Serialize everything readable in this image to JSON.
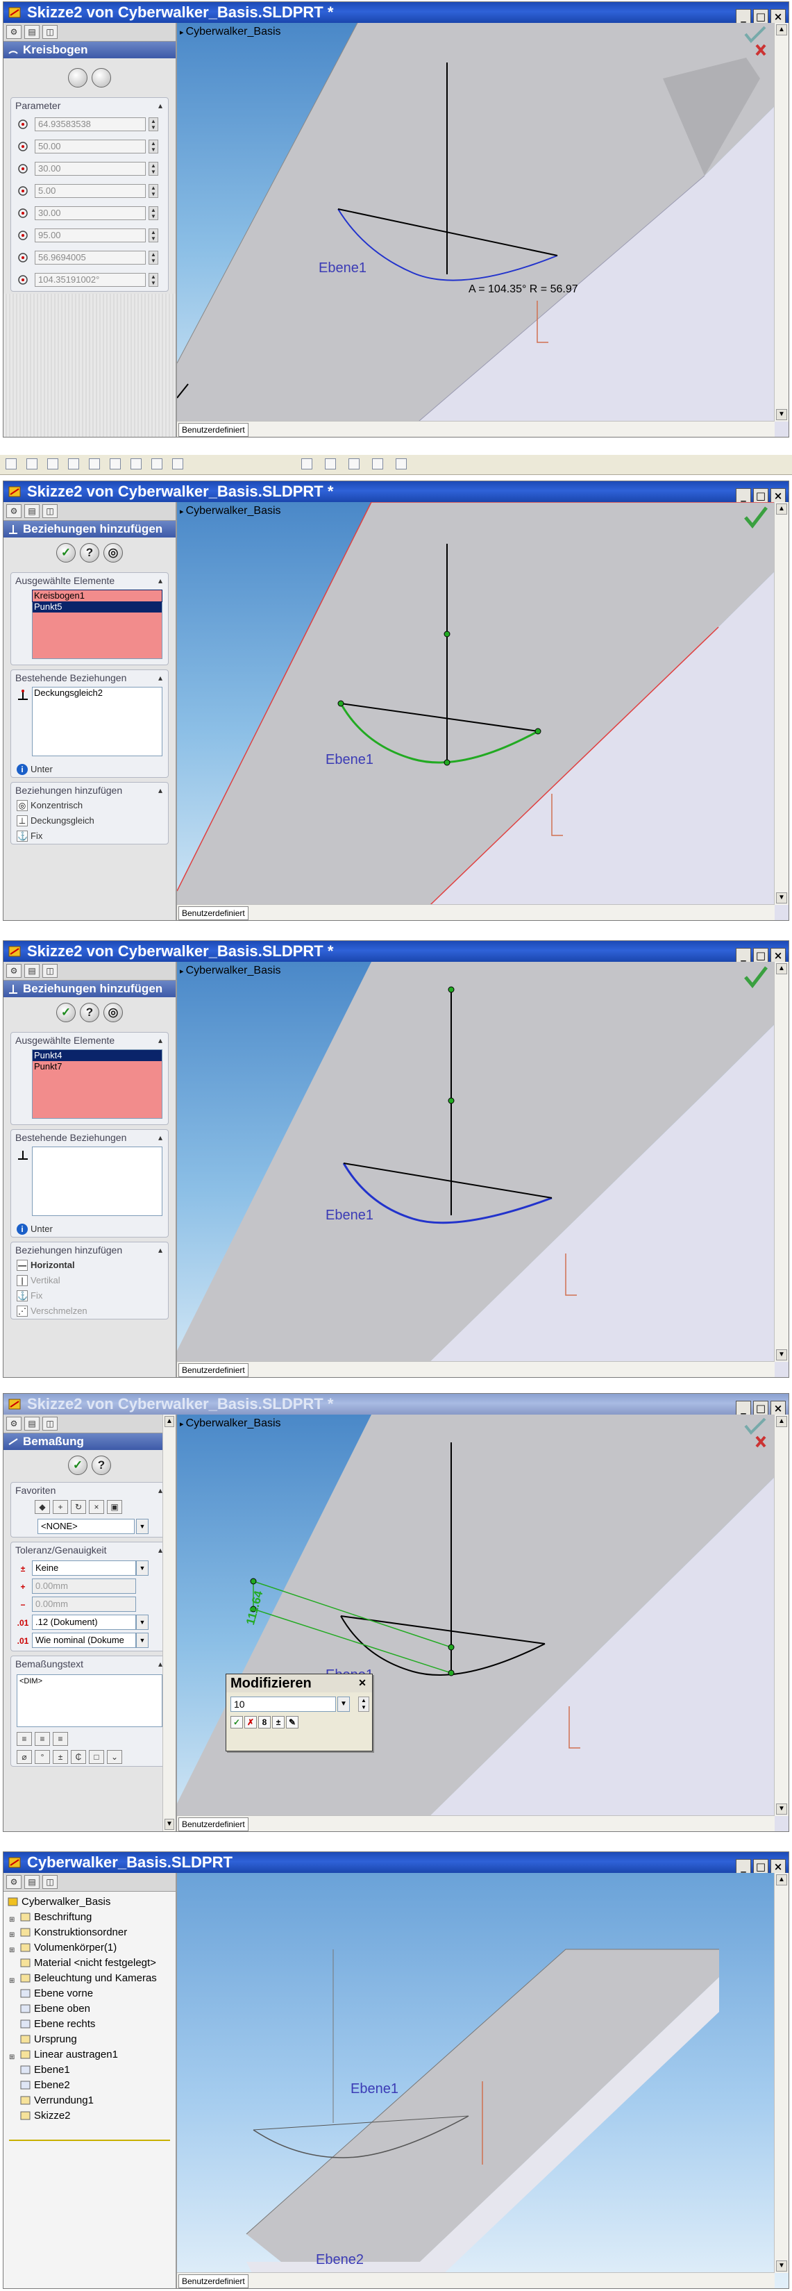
{
  "colors": {
    "titlebar_active": "#2f62d8",
    "selection": "#0a246a",
    "pink_listbox": "#f28c8c",
    "sketch_blue": "#2233cc",
    "sketch_green": "#22aa22",
    "sketch_black": "#000000",
    "plane_label": "#3b3bb5"
  },
  "toolbar": {
    "icons": [
      "select-icon",
      "sketch-icon",
      "line-icon",
      "rectangle-icon",
      "circle-icon",
      "arc-icon",
      "spline-icon",
      "point-icon",
      "centerline-icon",
      "trim-icon",
      "offset-icon",
      "mirror-icon",
      "relations-icon",
      "dimension-icon"
    ]
  },
  "win1": {
    "title": "Skizze2 von Cyberwalker_Basis.SLDPRT *",
    "pm_title": "Kreisbogen",
    "group_parameter": "Parameter",
    "params": [
      "64.93583538",
      "50.00",
      "30.00",
      "5.00",
      "30.00",
      "95.00",
      "56.9694005",
      "104.35191002°"
    ],
    "viewport_label": "Cyberwalker_Basis",
    "plane": "Ebene1",
    "dimension_text": "A = 104.35° R = 56.97",
    "view_tab": "Benutzerdefiniert"
  },
  "win2": {
    "title": "Skizze2 von Cyberwalker_Basis.SLDPRT *",
    "pm_title": "Beziehungen hinzufügen",
    "group_selected": "Ausgewählte Elemente",
    "selected": [
      "Kreisbogen1",
      "Punkt5"
    ],
    "group_existing": "Bestehende Beziehungen",
    "existing": [
      "Deckungsgleich2"
    ],
    "info": "Unter",
    "group_add": "Beziehungen hinzufügen",
    "add": [
      "Konzentrisch",
      "Deckungsgleich",
      "Fix"
    ],
    "viewport_label": "Cyberwalker_Basis",
    "plane": "Ebene1",
    "view_tab": "Benutzerdefiniert"
  },
  "win3": {
    "title": "Skizze2 von Cyberwalker_Basis.SLDPRT *",
    "pm_title": "Beziehungen hinzufügen",
    "group_selected": "Ausgewählte Elemente",
    "selected": [
      "Punkt4",
      "Punkt7"
    ],
    "group_existing": "Bestehende Beziehungen",
    "info": "Unter",
    "group_add": "Beziehungen hinzufügen",
    "add": [
      "Horizontal",
      "Vertikal",
      "Fix",
      "Verschmelzen"
    ],
    "viewport_label": "Cyberwalker_Basis",
    "plane": "Ebene1",
    "view_tab": "Benutzerdefiniert"
  },
  "win4": {
    "title": "Skizze2 von Cyberwalker_Basis.SLDPRT *",
    "pm_title": "Bemaßung",
    "group_fav": "Favoriten",
    "fav_value": "<NONE>",
    "group_tol": "Toleranz/Genauigkeit",
    "tol_type": "Keine",
    "tol_plus": "0.00mm",
    "tol_minus": "0.00mm",
    "precision": ".12 (Dokument)",
    "nominal": "Wie nominal (Dokume",
    "group_text": "Bemaßungstext",
    "dim_placeholder": "<DIM>",
    "dim_value": "111.64",
    "modify_title": "Modifizieren",
    "modify_value": "10",
    "viewport_label": "Cyberwalker_Basis",
    "plane": "Ebene1",
    "view_tab": "Benutzerdefiniert"
  },
  "win5": {
    "title": "Cyberwalker_Basis.SLDPRT",
    "tree": [
      "Cyberwalker_Basis",
      "Beschriftung",
      "Konstruktionsordner",
      "Volumenkörper(1)",
      "Material <nicht festgelegt>",
      "Beleuchtung und Kameras",
      "Ebene vorne",
      "Ebene oben",
      "Ebene rechts",
      "Ursprung",
      "Linear austragen1",
      "Ebene1",
      "Ebene2",
      "Verrundung1",
      "Skizze2"
    ],
    "plane1": "Ebene1",
    "plane2": "Ebene2",
    "view_tab": "Benutzerdefiniert"
  }
}
